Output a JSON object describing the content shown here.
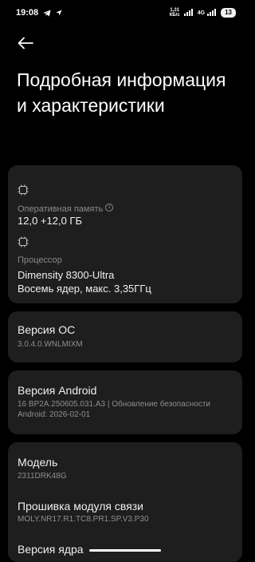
{
  "status_bar": {
    "time": "19:08",
    "net_speed_value": "1,31",
    "net_speed_unit": "КБ/с",
    "network_type": "4G",
    "battery": "13"
  },
  "title": "Подробная информация и характеристики",
  "cards": {
    "memory": {
      "label": "Оперативная память",
      "value": "12,0 +12,0 ГБ"
    },
    "processor": {
      "label": "Процессор",
      "value": "Dimensity 8300-Ultra",
      "detail": "Восемь ядер, макс. 3,35ГГц"
    },
    "os": {
      "label": "Версия ОС",
      "value": "3.0.4.0.WNLMIXM"
    },
    "android": {
      "label": "Версия Android",
      "line1": "16 BP2A.250605.031.A3 | Обновление безопасности",
      "line2": "Android: 2026-02-01"
    },
    "model": {
      "label": "Модель",
      "value": "2311DRK48G"
    },
    "baseband": {
      "label": "Прошивка модуля связи",
      "value": "MOLY.NR17.R1.TC8.PR1.SP.V3.P30"
    },
    "kernel": {
      "label": "Версия ядра"
    }
  }
}
